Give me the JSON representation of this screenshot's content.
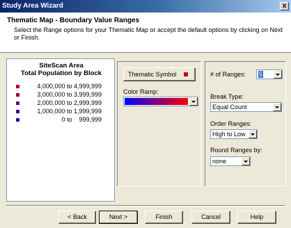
{
  "window": {
    "title": "Study Area Wizard",
    "close_label": "x"
  },
  "header": {
    "title": "Thematic Map - Boundary Value Ranges",
    "description": "Select the Range options for your Thematic Map or accept the default options by clicking on Next or Finish."
  },
  "legend": {
    "title_line1": "SiteScan Area",
    "title_line2": "Total Population by Block",
    "rows": [
      {
        "range": "4,000,000 to 4,999,999",
        "color": "#b80030"
      },
      {
        "range": "3,000,000 to 3,999,999",
        "color": "#900060"
      },
      {
        "range": "2,000,000 to 2,999,999",
        "color": "#700090"
      },
      {
        "range": "1,000,000 to 1,999,999",
        "color": "#4000b0"
      },
      {
        "range": "0 to    999,999",
        "color": "#1010d0"
      }
    ]
  },
  "symbol": {
    "thematic_symbol_label": "Thematic Symbol",
    "swatch_color": "#c00000",
    "color_ramp_label": "Color Ramp:",
    "ramp_start_color": "#0000ff",
    "ramp_end_color": "#ff0000"
  },
  "ranges": {
    "num_ranges_label": "# of Ranges:",
    "num_ranges_value": "5",
    "break_type_label": "Break Type:",
    "break_type_value": "Equal Count",
    "order_label": "Order Ranges:",
    "order_value": "High to Low",
    "round_label": "Round Ranges by:",
    "round_value": "none"
  },
  "footer": {
    "back_label": "< Back",
    "next_label": "Next >",
    "finish_label": "Finish",
    "cancel_label": "Cancel",
    "help_label": "Help"
  }
}
